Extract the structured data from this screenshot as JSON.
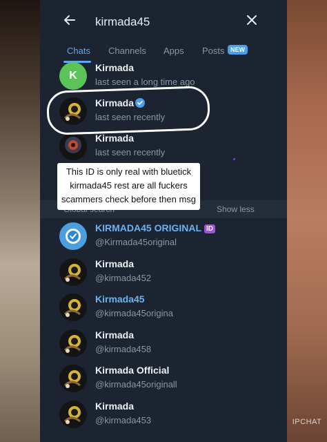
{
  "search": {
    "query": "kirmada45"
  },
  "tabs": [
    {
      "label": "Chats",
      "active": true
    },
    {
      "label": "Channels"
    },
    {
      "label": "Apps"
    },
    {
      "label": "Posts",
      "badge": "NEW"
    }
  ],
  "chats": [
    {
      "name": "Kirmada",
      "status": "last seen a long time ago",
      "avatar_letter": "K"
    },
    {
      "name": "Kirmada",
      "status": "last seen recently",
      "verified": true
    },
    {
      "name": "Kirmada",
      "status": "last seen recently"
    }
  ],
  "global": {
    "title": "Global search",
    "toggle": "Show less"
  },
  "results": [
    {
      "name": "KIRMADA45 ORIGINAL",
      "badge": "ID",
      "handle": "@Kirmada45original"
    },
    {
      "name": "Kirmada",
      "handle": "@kirmada452"
    },
    {
      "name": "Kirmada45",
      "handle": "@kirmada45origina"
    },
    {
      "name": "Kirmada",
      "handle": "@kirmada458"
    },
    {
      "name": "Kirmada Official",
      "handle": "@kirmada45originall"
    },
    {
      "name": "Kirmada",
      "handle": "@kirmada453"
    }
  ],
  "overlay": {
    "lines": [
      "This ID is only real with bluetick",
      "kirmada45  rest are all fuckers",
      "scammers  check before then msg"
    ]
  },
  "watermark": "IPCHAT",
  "icons": {
    "back": "arrow-left-icon",
    "close": "close-icon",
    "verified": "verified-badge-icon"
  },
  "colors": {
    "accent": "#5ea8ef",
    "background": "#1b2430",
    "verified": "#4d9ee8",
    "id_badge": "#9b54d6"
  }
}
